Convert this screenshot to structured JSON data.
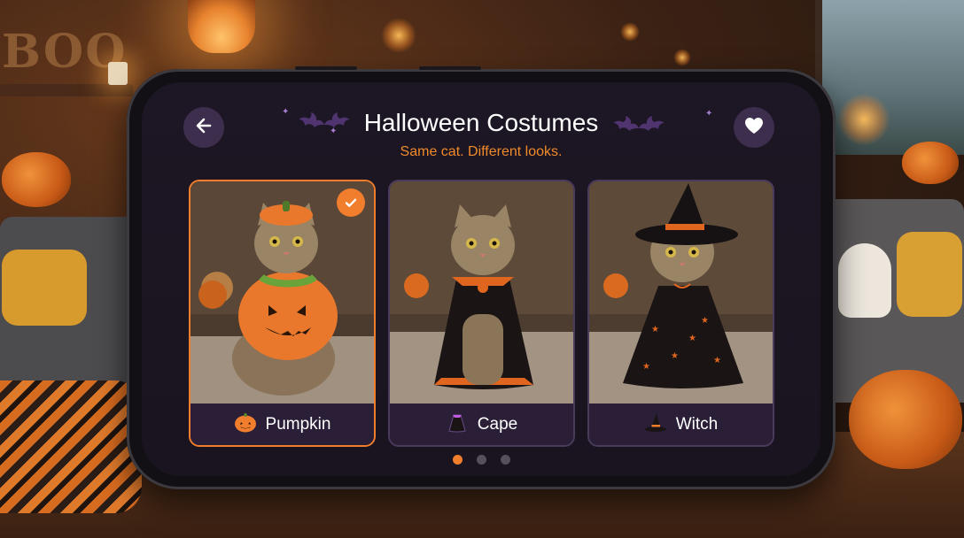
{
  "background": {
    "sign_text": "BOO"
  },
  "header": {
    "title": "Halloween Costumes",
    "subtitle": "Same cat. Different looks.",
    "back_icon": "arrow-left-icon",
    "favorite_icon": "heart-icon"
  },
  "costumes": [
    {
      "label": "Pumpkin",
      "icon": "pumpkin-icon",
      "selected": true
    },
    {
      "label": "Cape",
      "icon": "cape-icon",
      "selected": false
    },
    {
      "label": "Witch",
      "icon": "witch-hat-icon",
      "selected": false
    }
  ],
  "pagination": {
    "total": 3,
    "current": 1
  },
  "colors": {
    "accent": "#f07e2c",
    "screen_bg": "#1d1624",
    "card_bg": "#2a2035",
    "button_bg": "#3d2e4d"
  }
}
